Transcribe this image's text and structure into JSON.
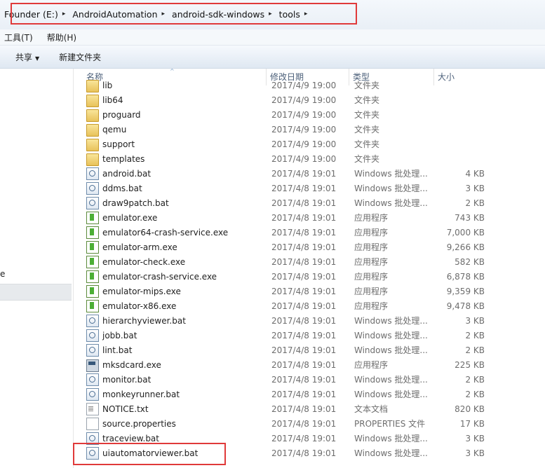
{
  "address": {
    "crumbs": [
      "Founder (E:)",
      "AndroidAutomation",
      "android-sdk-windows",
      "tools"
    ],
    "separator": "▸"
  },
  "menu": {
    "items": [
      "工具(T)",
      "帮助(H)"
    ]
  },
  "toolbar": {
    "share_label": "共享",
    "share_caret": "▼",
    "new_folder_label": "新建文件夹"
  },
  "nav": {
    "partial_text": "e"
  },
  "columns": {
    "name": "名称",
    "sort_arrow": "^",
    "date": "修改日期",
    "type": "类型",
    "size": "大小"
  },
  "files": [
    {
      "name": "lib",
      "date": "2017/4/9 19:00",
      "type": "文件夹",
      "size": "",
      "icon": "folder-icon",
      "partial": true
    },
    {
      "name": "lib64",
      "date": "2017/4/9 19:00",
      "type": "文件夹",
      "size": "",
      "icon": "folder-icon"
    },
    {
      "name": "proguard",
      "date": "2017/4/9 19:00",
      "type": "文件夹",
      "size": "",
      "icon": "folder-icon"
    },
    {
      "name": "qemu",
      "date": "2017/4/9 19:00",
      "type": "文件夹",
      "size": "",
      "icon": "folder-icon"
    },
    {
      "name": "support",
      "date": "2017/4/9 19:00",
      "type": "文件夹",
      "size": "",
      "icon": "folder-icon"
    },
    {
      "name": "templates",
      "date": "2017/4/9 19:00",
      "type": "文件夹",
      "size": "",
      "icon": "folder-icon"
    },
    {
      "name": "android.bat",
      "date": "2017/4/8 19:01",
      "type": "Windows 批处理...",
      "size": "4 KB",
      "icon": "batch-file-icon"
    },
    {
      "name": "ddms.bat",
      "date": "2017/4/8 19:01",
      "type": "Windows 批处理...",
      "size": "3 KB",
      "icon": "batch-file-icon"
    },
    {
      "name": "draw9patch.bat",
      "date": "2017/4/8 19:01",
      "type": "Windows 批处理...",
      "size": "2 KB",
      "icon": "batch-file-icon"
    },
    {
      "name": "emulator.exe",
      "date": "2017/4/8 19:01",
      "type": "应用程序",
      "size": "743 KB",
      "icon": "executable-icon"
    },
    {
      "name": "emulator64-crash-service.exe",
      "date": "2017/4/8 19:01",
      "type": "应用程序",
      "size": "7,000 KB",
      "icon": "executable-icon"
    },
    {
      "name": "emulator-arm.exe",
      "date": "2017/4/8 19:01",
      "type": "应用程序",
      "size": "9,266 KB",
      "icon": "executable-icon"
    },
    {
      "name": "emulator-check.exe",
      "date": "2017/4/8 19:01",
      "type": "应用程序",
      "size": "582 KB",
      "icon": "executable-icon"
    },
    {
      "name": "emulator-crash-service.exe",
      "date": "2017/4/8 19:01",
      "type": "应用程序",
      "size": "6,878 KB",
      "icon": "executable-icon"
    },
    {
      "name": "emulator-mips.exe",
      "date": "2017/4/8 19:01",
      "type": "应用程序",
      "size": "9,359 KB",
      "icon": "executable-icon"
    },
    {
      "name": "emulator-x86.exe",
      "date": "2017/4/8 19:01",
      "type": "应用程序",
      "size": "9,478 KB",
      "icon": "executable-icon"
    },
    {
      "name": "hierarchyviewer.bat",
      "date": "2017/4/8 19:01",
      "type": "Windows 批处理...",
      "size": "3 KB",
      "icon": "batch-file-icon"
    },
    {
      "name": "jobb.bat",
      "date": "2017/4/8 19:01",
      "type": "Windows 批处理...",
      "size": "2 KB",
      "icon": "batch-file-icon"
    },
    {
      "name": "lint.bat",
      "date": "2017/4/8 19:01",
      "type": "Windows 批处理...",
      "size": "2 KB",
      "icon": "batch-file-icon"
    },
    {
      "name": "mksdcard.exe",
      "date": "2017/4/8 19:01",
      "type": "应用程序",
      "size": "225 KB",
      "icon": "console-app-icon"
    },
    {
      "name": "monitor.bat",
      "date": "2017/4/8 19:01",
      "type": "Windows 批处理...",
      "size": "2 KB",
      "icon": "batch-file-icon"
    },
    {
      "name": "monkeyrunner.bat",
      "date": "2017/4/8 19:01",
      "type": "Windows 批处理...",
      "size": "2 KB",
      "icon": "batch-file-icon"
    },
    {
      "name": "NOTICE.txt",
      "date": "2017/4/8 19:01",
      "type": "文本文档",
      "size": "820 KB",
      "icon": "text-file-icon"
    },
    {
      "name": "source.properties",
      "date": "2017/4/8 19:01",
      "type": "PROPERTIES 文件",
      "size": "17 KB",
      "icon": "properties-file-icon"
    },
    {
      "name": "traceview.bat",
      "date": "2017/4/8 19:01",
      "type": "Windows 批处理...",
      "size": "3 KB",
      "icon": "batch-file-icon"
    },
    {
      "name": "uiautomatorviewer.bat",
      "date": "2017/4/8 19:01",
      "type": "Windows 批处理...",
      "size": "3 KB",
      "icon": "batch-file-icon"
    }
  ],
  "colors": {
    "highlight": "#e03a3a",
    "header_text": "#4c607a"
  }
}
